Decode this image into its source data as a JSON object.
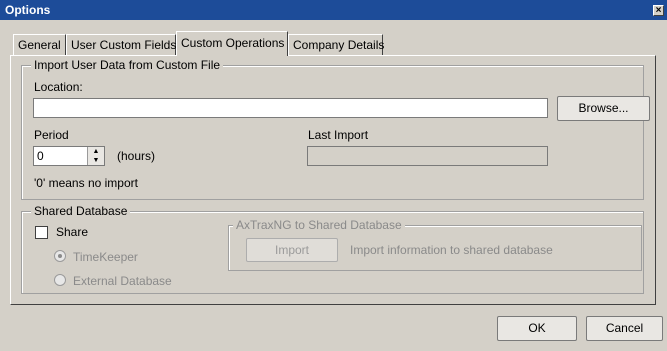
{
  "window": {
    "title": "Options",
    "close_glyph": "×"
  },
  "tabs": [
    {
      "label": "General"
    },
    {
      "label": "User Custom Fields"
    },
    {
      "label": "Custom Operations"
    },
    {
      "label": "Company Details"
    }
  ],
  "import_group": {
    "legend": "Import User Data from Custom File",
    "location_label": "Location:",
    "location_value": "",
    "browse_label": "Browse...",
    "period_label": "Period",
    "period_value": "0",
    "period_unit": "(hours)",
    "hint": "'0' means no import",
    "last_import_label": "Last Import",
    "last_import_value": ""
  },
  "shared_group": {
    "legend": "Shared Database",
    "share_label": "Share",
    "share_checked": false,
    "radio_options": [
      {
        "label": "TimeKeeper",
        "selected": true
      },
      {
        "label": "External Database",
        "selected": false
      }
    ],
    "sub_group": {
      "legend": "AxTraxNG to Shared Database",
      "import_label": "Import",
      "import_info": "Import information to shared database"
    }
  },
  "footer": {
    "ok_label": "OK",
    "cancel_label": "Cancel"
  },
  "colors": {
    "titlebar": "#1d4c99",
    "face": "#d4d0c8"
  }
}
